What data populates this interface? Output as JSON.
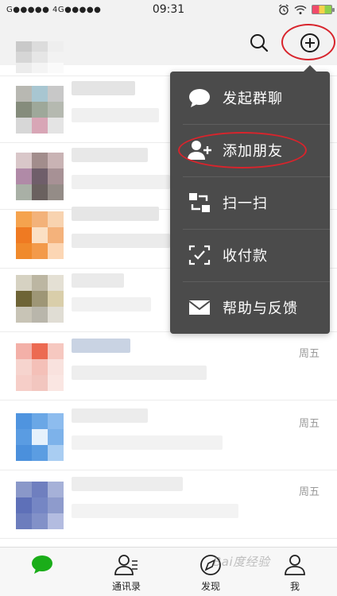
{
  "status_bar": {
    "carrier": "G●●●●● 4G●●●●●",
    "time": "09:31",
    "battery_icon": "battery-icon",
    "wifi_icon": "wifi-icon",
    "alarm_icon": "alarm-icon"
  },
  "top_bar": {
    "search_icon": "search-icon",
    "add_icon": "plus-circle-icon"
  },
  "menu": {
    "items": [
      {
        "label": "发起群聊",
        "icon": "chat-bubble-icon"
      },
      {
        "label": "添加朋友",
        "icon": "add-friend-icon"
      },
      {
        "label": "扫一扫",
        "icon": "scan-icon"
      },
      {
        "label": "收付款",
        "icon": "payment-icon"
      },
      {
        "label": "帮助与反馈",
        "icon": "mail-icon"
      }
    ]
  },
  "chat_list": {
    "rows": [
      {
        "time": ""
      },
      {
        "time": ""
      },
      {
        "time": ""
      },
      {
        "time": ""
      },
      {
        "time": "周五"
      },
      {
        "time": "周五"
      },
      {
        "time": "周五"
      }
    ]
  },
  "tabs": [
    {
      "label": "",
      "icon": "chats-icon",
      "active": true
    },
    {
      "label": "通讯录",
      "icon": "contacts-icon"
    },
    {
      "label": "发现",
      "icon": "compass-icon"
    },
    {
      "label": "我",
      "icon": "me-icon"
    }
  ],
  "colors": {
    "accent": "#1aad19",
    "menu_bg": "#4b4b4b",
    "annotation_red": "#d8242c"
  },
  "watermark": "Bai度经验"
}
